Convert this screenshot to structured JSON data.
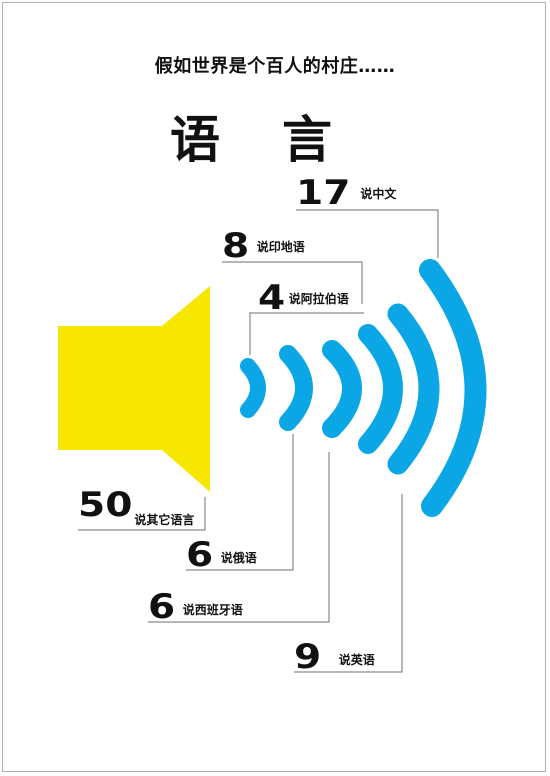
{
  "header": {
    "title": "假如世界是个百人的村庄……",
    "subject": "语言"
  },
  "colors": {
    "speaker": "#f7e600",
    "wave": "#0aa6e6",
    "connector": "#8a8a8a",
    "text": "#111111"
  },
  "languages": [
    {
      "count": "17",
      "name": "说中文"
    },
    {
      "count": "8",
      "name": "说印地语"
    },
    {
      "count": "4",
      "name": "说阿拉伯语"
    },
    {
      "count": "50",
      "name": "说其它语言"
    },
    {
      "count": "6",
      "name": "说俄语"
    },
    {
      "count": "6",
      "name": "说西班牙语"
    },
    {
      "count": "9",
      "name": "说英语"
    }
  ],
  "icons": {
    "speaker": "speaker-icon",
    "waves": "sound-wave-icon"
  }
}
